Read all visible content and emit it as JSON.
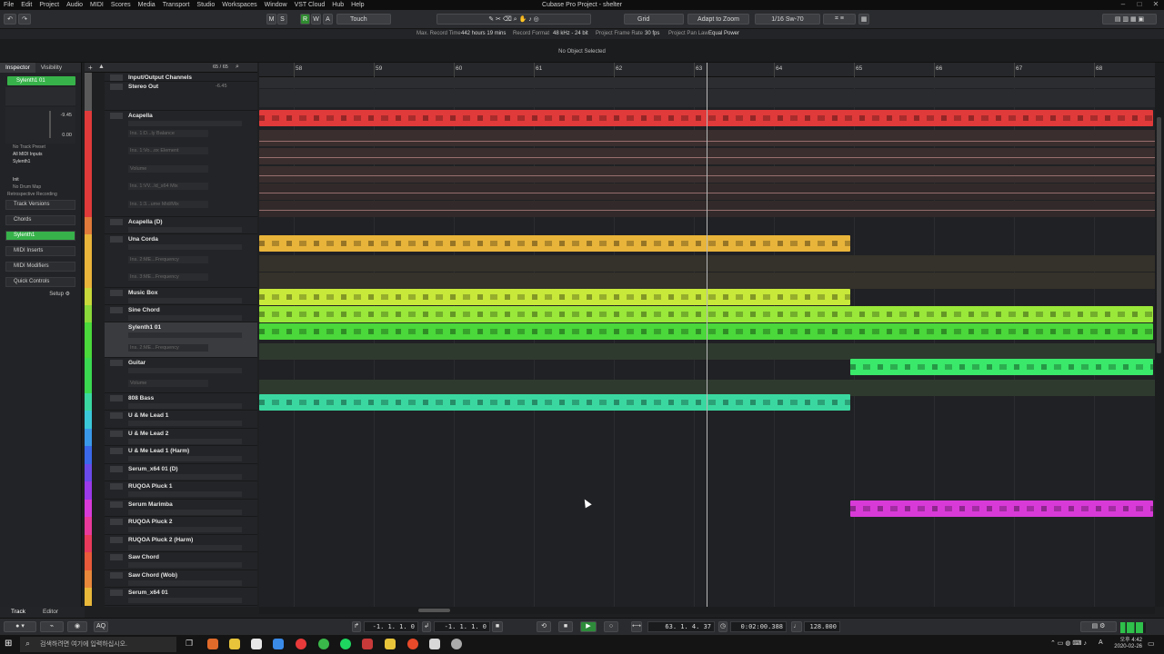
{
  "menu": [
    "File",
    "Edit",
    "Project",
    "Audio",
    "MIDI",
    "Scores",
    "Media",
    "Transport",
    "Studio",
    "Workspaces",
    "Window",
    "VST Cloud",
    "Hub",
    "Help"
  ],
  "window_title": "Cubase Pro Project - shelter",
  "toolbar": {
    "automation_mode": "Touch",
    "grid_mode": "Grid",
    "zoom_mode": "Adapt to Zoom",
    "quantize": "1/16 Sw-70",
    "m": "M",
    "s": "S",
    "r": "R",
    "w": "W",
    "a": "A"
  },
  "status": {
    "max_rec_label": "Max. Record Time",
    "max_rec_value": "442 hours 19 mins",
    "format_label": "Record Format",
    "format_value": "48 kHz - 24 bit",
    "framerate_label": "Project Frame Rate",
    "framerate_value": "30 fps",
    "panlaw_label": "Project Pan Law",
    "panlaw_value": "Equal Power"
  },
  "info_line": "No Object Selected",
  "inspector": {
    "tabs": [
      "Inspector",
      "Visibility"
    ],
    "track_name": "Sylenth1 01",
    "volume_value": "-9.45",
    "pan_value": "0.00",
    "lines": [
      "No Track Preset",
      "All MIDI Inputs",
      "Sylenth1",
      "Init",
      "No Drum Map",
      "Retrospective Recording"
    ],
    "sections": [
      "Track Versions",
      "Chords",
      "Sylenth1",
      "MIDI Inserts",
      "MIDI Modifiers",
      "Quick Controls"
    ],
    "setup_label": "Setup"
  },
  "tracklist_header": {
    "count": "65 / 65"
  },
  "tracks": [
    {
      "name": "Input/Output Channels",
      "color": "#5a5a5a"
    },
    {
      "name": "Stereo Out",
      "color": "#5a5a5a",
      "sub": "-6.45"
    },
    {
      "name": "Acapella",
      "color": "#e03a3a"
    },
    {
      "name": "Acapella (D)",
      "color": "#e07a3a"
    },
    {
      "name": "Una Corda",
      "color": "#e8b43a"
    },
    {
      "name": "Music Box",
      "color": "#c8d83a"
    },
    {
      "name": "Sine Chord",
      "color": "#8ad83a"
    },
    {
      "name": "Sylenth1 01",
      "color": "#4ad83a"
    },
    {
      "name": "Guitar",
      "color": "#3ad850"
    },
    {
      "name": "808 Bass",
      "color": "#3ad8a0"
    },
    {
      "name": "U & Me Lead 1",
      "color": "#3ac8d8"
    },
    {
      "name": "U & Me Lead 2",
      "color": "#3a98e8"
    },
    {
      "name": "U & Me Lead 1 (Harm)",
      "color": "#3a68e8"
    },
    {
      "name": "Serum_x64 01 (D)",
      "color": "#6a4ae8"
    },
    {
      "name": "RUQOA Pluck 1",
      "color": "#9a3ae8"
    },
    {
      "name": "Serum Marimba",
      "color": "#d83ad8"
    },
    {
      "name": "RUQOA Pluck 2",
      "color": "#e83a9a"
    },
    {
      "name": "RUQOA Pluck 2 (Harm)",
      "color": "#e83a5a"
    },
    {
      "name": "Saw Chord",
      "color": "#e85a3a"
    },
    {
      "name": "Saw Chord (Wob)",
      "color": "#e8883a"
    },
    {
      "name": "Serum_x64 01",
      "color": "#e8b83a"
    }
  ],
  "automation_labels": [
    "Ins. 1:D...ly Balance",
    "Ins. 1:Vo...ox Element",
    "Volume",
    "Ins. 1:VV...ld_s64 Mix",
    "Ins. 1:3...ume Mid/Mix",
    "Ins. 2:ME...Frequency",
    "Ins. 3:ME...Frequency",
    "Volume",
    "Ins. 3:ME...Frequency",
    "Volume"
  ],
  "ruler_bars": [
    "58",
    "59",
    "60",
    "61",
    "62",
    "63",
    "64",
    "65",
    "66",
    "67",
    "68"
  ],
  "bottom_tabs": [
    "Track",
    "Editor"
  ],
  "transport": {
    "left_locator": "-1. 1. 1.  0",
    "right_locator": "-1. 1. 1.  0",
    "position_bars": "63. 1. 4. 37",
    "position_time": "0:02:00.388",
    "tempo": "128.000"
  },
  "taskbar": {
    "search_placeholder": "검색하려면 여기에 입력하십시오.",
    "time": "오후 4:42",
    "date": "2020-02-26",
    "ime": "A"
  },
  "colors": {
    "red": "#e03a3a",
    "orange": "#e8b43a",
    "lime": "#c8e83a",
    "green": "#4ad83a",
    "teal": "#3ad880",
    "mint": "#3ad8a0",
    "magenta": "#d83ad8"
  }
}
